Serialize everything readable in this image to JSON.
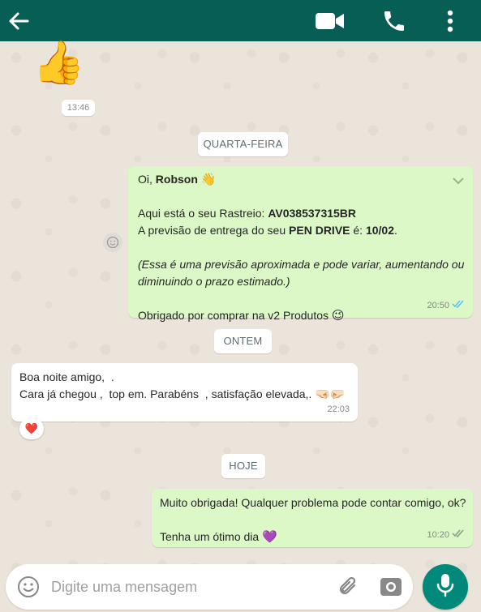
{
  "header": {
    "back_icon": "arrow-left-icon",
    "video_icon": "video-camera-icon",
    "call_icon": "phone-icon",
    "more_icon": "more-vertical-icon",
    "bg_color": "#075e54"
  },
  "messages": {
    "thumb": {
      "emoji": "👍",
      "time": "13:46"
    },
    "sep_wednesday": "QUARTA-FEIRA",
    "msg1": {
      "greeting": "Oi, ",
      "name": "Robson",
      "wave": "👋",
      "tracking_prefix": "Aqui está o seu Rastreio: ",
      "tracking_code": "AV038537315BR",
      "forecast_prefix": "A previsão de entrega do seu ",
      "product": "PEN DRIVE",
      "forecast_mid": " é: ",
      "date": "10/02",
      "forecast_end": ".",
      "note_line1": "(Essa é uma previsão aproximada e pode variar, aumentando ou",
      "note_line2": "diminuindo o prazo estimado.)",
      "thanks": "Obrigado por comprar na v2 Produtos ",
      "wink": "😉",
      "time": "20:50"
    },
    "sep_yesterday": "ONTEM",
    "msg2": {
      "line1": "Boa noite amigo,  .",
      "line2": "Cara já chegou ,  top em. Parabéns  , satisfação elevada,. ",
      "fists": "🤜🏻🤛🏻",
      "time": "22:03",
      "reaction": "❤️"
    },
    "sep_today": "HOJE",
    "msg3": {
      "line1": "Muito obrigada! Qualquer problema pode contar comigo, ok?",
      "line2": "Tenha um ótimo dia ",
      "heart": "💜",
      "time": "10:20"
    }
  },
  "input": {
    "placeholder": "Digite uma mensagem",
    "emoji_icon": "emoji-icon",
    "attach_icon": "paperclip-icon",
    "camera_icon": "camera-icon",
    "mic_icon": "microphone-icon",
    "mic_color": "#00897b"
  }
}
